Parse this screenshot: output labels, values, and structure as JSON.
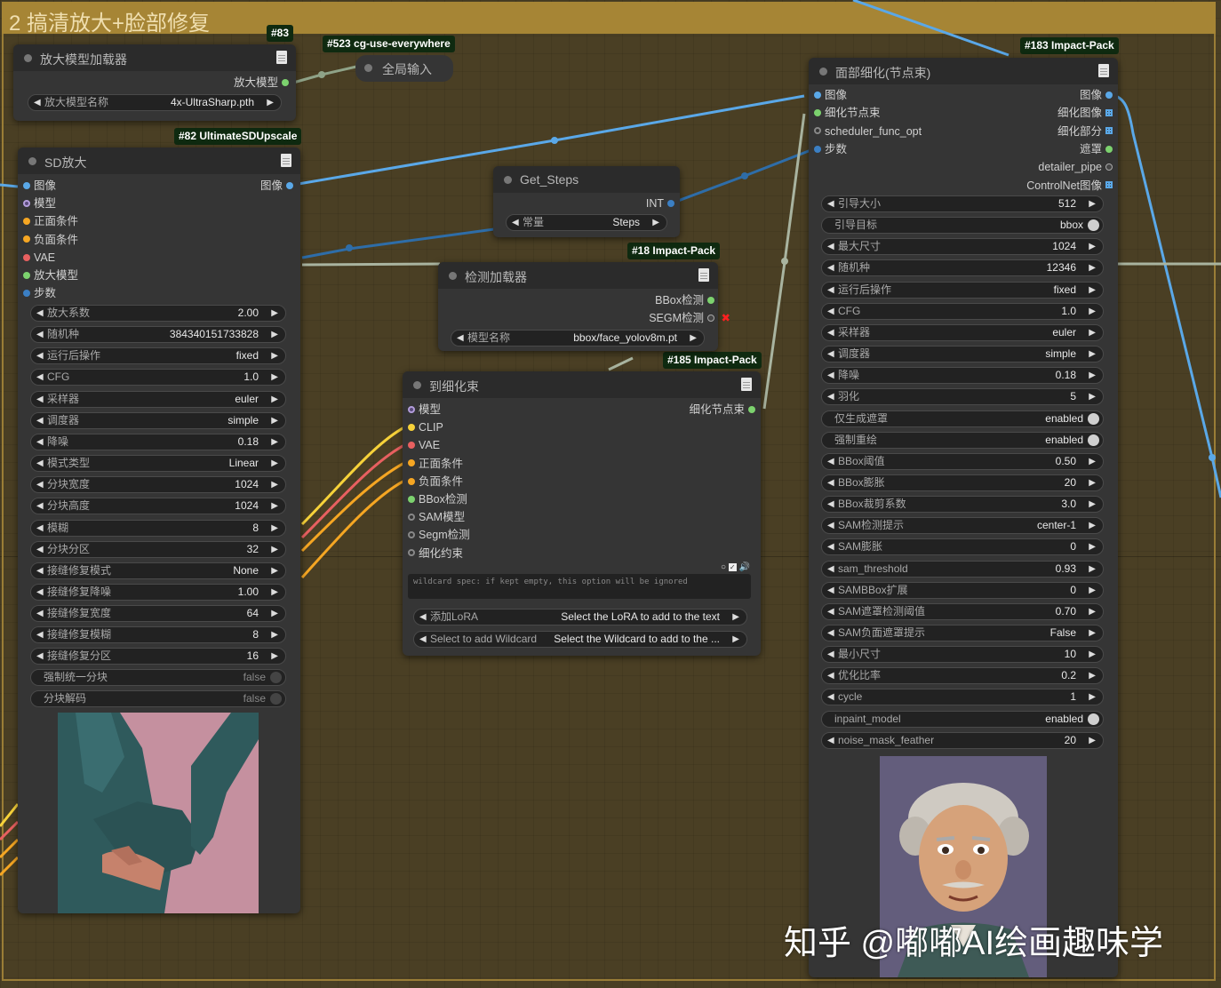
{
  "group": {
    "title": "2 搞清放大+脸部修复"
  },
  "badges": {
    "b83": "#83",
    "b523": "#523 cg-use-everywhere",
    "b82": "#82 UltimateSDUpscale",
    "b18": "#18 Impact-Pack",
    "b185": "#185 Impact-Pack",
    "b183": "#183 Impact-Pack"
  },
  "upscale_loader": {
    "title": "放大模型加载器",
    "output": "放大模型",
    "widget": {
      "label": "放大模型名称",
      "value": "4x-UltraSharp.pth"
    }
  },
  "global_input": {
    "title": "全局输入"
  },
  "sd_upscale": {
    "title": "SD放大",
    "inputs": [
      "图像",
      "模型",
      "正面条件",
      "负面条件",
      "VAE",
      "放大模型",
      "步数"
    ],
    "output": "图像",
    "widgets": [
      {
        "label": "放大系数",
        "value": "2.00"
      },
      {
        "label": "随机种",
        "value": "384340151733828"
      },
      {
        "label": "运行后操作",
        "value": "fixed"
      },
      {
        "label": "CFG",
        "value": "1.0"
      },
      {
        "label": "采样器",
        "value": "euler"
      },
      {
        "label": "调度器",
        "value": "simple"
      },
      {
        "label": "降噪",
        "value": "0.18"
      },
      {
        "label": "模式类型",
        "value": "Linear"
      },
      {
        "label": "分块宽度",
        "value": "1024"
      },
      {
        "label": "分块高度",
        "value": "1024"
      },
      {
        "label": "模糊",
        "value": "8"
      },
      {
        "label": "分块分区",
        "value": "32"
      },
      {
        "label": "接缝修复模式",
        "value": "None"
      },
      {
        "label": "接缝修复降噪",
        "value": "1.00"
      },
      {
        "label": "接缝修复宽度",
        "value": "64"
      },
      {
        "label": "接缝修复模糊",
        "value": "8"
      },
      {
        "label": "接缝修复分区",
        "value": "16"
      }
    ],
    "toggles": [
      {
        "label": "强制统一分块",
        "value": "false"
      },
      {
        "label": "分块解码",
        "value": "false"
      }
    ]
  },
  "get_steps": {
    "title": "Get_Steps",
    "output": "INT",
    "widget": {
      "label": "常量",
      "value": "Steps"
    }
  },
  "detector_loader": {
    "title": "检测加载器",
    "outputs": [
      "BBox检测",
      "SEGM检测"
    ],
    "widget": {
      "label": "模型名称",
      "value": "bbox/face_yolov8m.pt"
    }
  },
  "to_detailer_pipe": {
    "title": "到细化束",
    "inputs": [
      "模型",
      "CLIP",
      "VAE",
      "正面条件",
      "负面条件",
      "BBox检测",
      "SAM模型",
      "Segm检测",
      "细化约束"
    ],
    "output": "细化节点束",
    "wildcard_placeholder": "wildcard spec: if kept empty, this option will be ignored",
    "lora_widget": {
      "label": "添加LoRA",
      "value": "Select the LoRA to add to the text"
    },
    "wildcard_widget": {
      "label": "Select to add Wildcard",
      "value": "Select the Wildcard to add to the ..."
    }
  },
  "face_detailer": {
    "title": "面部细化(节点束)",
    "inputs": [
      "图像",
      "细化节点束",
      "scheduler_func_opt",
      "步数"
    ],
    "outputs": [
      "图像",
      "细化图像",
      "细化部分",
      "遮罩",
      "detailer_pipe",
      "ControlNet图像"
    ],
    "widgets": [
      {
        "label": "引导大小",
        "value": "512",
        "kind": "num"
      },
      {
        "label": "引导目标",
        "value": "bbox",
        "kind": "toggle",
        "on": true
      },
      {
        "label": "最大尺寸",
        "value": "1024",
        "kind": "num"
      },
      {
        "label": "随机种",
        "value": "12346",
        "kind": "num"
      },
      {
        "label": "运行后操作",
        "value": "fixed",
        "kind": "num"
      },
      {
        "label": "CFG",
        "value": "1.0",
        "kind": "num"
      },
      {
        "label": "采样器",
        "value": "euler",
        "kind": "num"
      },
      {
        "label": "调度器",
        "value": "simple",
        "kind": "num"
      },
      {
        "label": "降噪",
        "value": "0.18",
        "kind": "num"
      },
      {
        "label": "羽化",
        "value": "5",
        "kind": "num"
      },
      {
        "label": "仅生成遮罩",
        "value": "enabled",
        "kind": "toggle",
        "on": true
      },
      {
        "label": "强制重绘",
        "value": "enabled",
        "kind": "toggle",
        "on": true
      },
      {
        "label": "BBox阈值",
        "value": "0.50",
        "kind": "num"
      },
      {
        "label": "BBox膨胀",
        "value": "20",
        "kind": "num"
      },
      {
        "label": "BBox裁剪系数",
        "value": "3.0",
        "kind": "num"
      },
      {
        "label": "SAM检测提示",
        "value": "center-1",
        "kind": "num"
      },
      {
        "label": "SAM膨胀",
        "value": "0",
        "kind": "num"
      },
      {
        "label": "sam_threshold",
        "value": "0.93",
        "kind": "num"
      },
      {
        "label": "SAMBBox扩展",
        "value": "0",
        "kind": "num"
      },
      {
        "label": "SAM遮罩检测阈值",
        "value": "0.70",
        "kind": "num"
      },
      {
        "label": "SAM负面遮罩提示",
        "value": "False",
        "kind": "num"
      },
      {
        "label": "最小尺寸",
        "value": "10",
        "kind": "num"
      },
      {
        "label": "优化比率",
        "value": "0.2",
        "kind": "num"
      },
      {
        "label": "cycle",
        "value": "1",
        "kind": "num"
      },
      {
        "label": "inpaint_model",
        "value": "enabled",
        "kind": "toggle",
        "on": true
      },
      {
        "label": "noise_mask_feather",
        "value": "20",
        "kind": "num"
      }
    ]
  },
  "watermark": "知乎 @嘟嘟AI绘画趣味学",
  "colors": {
    "image": "#5aa8e8",
    "model": "#b39ddb",
    "conditioning": "#f5a623",
    "vae": "#e86060",
    "upscale_model": "#7cd26e",
    "int": "#3b7fc4",
    "clip": "#f7d23a",
    "pipe": "#7cd26e",
    "link_gray": "#a9b4a0"
  }
}
